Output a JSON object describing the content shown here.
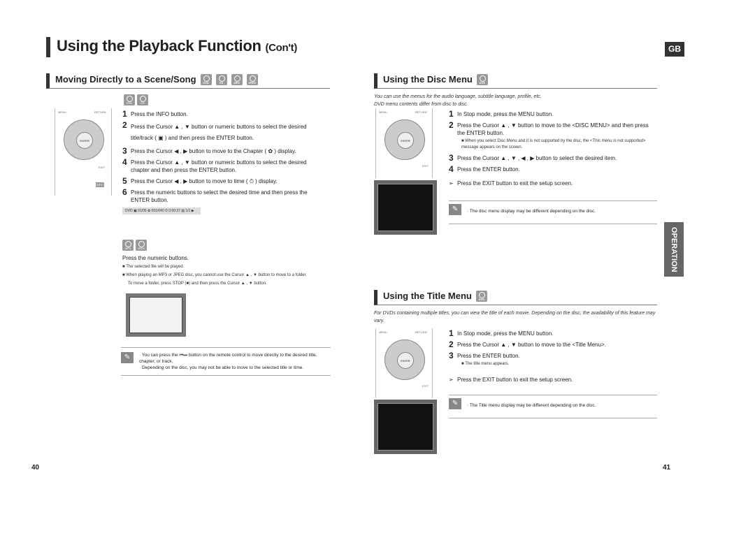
{
  "header": {
    "title": "Using the Playback Function",
    "title_suffix": "(Con't)",
    "lang_badge": "GB"
  },
  "side_tab": "OPERATION",
  "page_left": "40",
  "page_right": "41",
  "scene": {
    "heading": "Moving Directly to a Scene/Song",
    "discs": [
      "DVD",
      "CD",
      "MP3",
      "JPEG"
    ],
    "sub_discs": [
      "DVD",
      "CD"
    ],
    "steps": [
      {
        "n": "1",
        "text": "Press the INFO button."
      },
      {
        "n": "2",
        "text": "Press the Cursor ▲ , ▼ button or numeric buttons to select the desired title/track ( ▣ )  and then press the ENTER button."
      },
      {
        "n": "3",
        "text": "Press the Cursor ◀ , ▶ button to move to the Chapter ( ✿ ) display."
      },
      {
        "n": "4",
        "text": "Press the Cursor ▲ , ▼ button or numeric buttons to select the desired chapter and then press the ENTER button."
      },
      {
        "n": "5",
        "text": "Press the Cursor ◀ , ▶ button to move to time ( ⏱ )  display."
      },
      {
        "n": "6",
        "text": "Press the numeric buttons to select the desired time and then press the ENTER button."
      }
    ],
    "info_bar": "DVD ▣ 01/05 ✿ 001/040 ⏱ 0:00:37 ▤ 1/1 ▶",
    "mp3_discs": [
      "MP3",
      "JPEG"
    ],
    "mp3_lead": "Press the numeric buttons.",
    "mp3_notes": [
      "The selected file will be played.",
      "When playing an MP3 or JPEG disc, you cannot use the Cursor ▲ , ▼ button to move to a folder.",
      "To move a folder, press STOP (■) and then press the Cursor ▲ , ▼ button."
    ],
    "notes": [
      "· You can press the ⏮⏭ button on the remote control to move directly to the desired title, chapter, or track.",
      "· Depending on the disc, you may not be able to move to the selected title or time."
    ]
  },
  "remote": {
    "menu": "MENU",
    "return": "RETURN",
    "enter": "ENTER",
    "exit": "EXIT",
    "info": "INFO"
  },
  "disc_menu": {
    "heading": "Using the Disc Menu",
    "disc": "DVD",
    "intro": "You can use the menus for the audio language, subtitle language, profile, etc.",
    "intro2": "DVD menu contents differ from disc to disc.",
    "steps": [
      {
        "n": "1",
        "text": "In Stop mode, press the MENU button."
      },
      {
        "n": "2",
        "text": "Press the Cursor ▲ , ▼ button to move to the <DISC MENU> and then press the ENTER button."
      },
      {
        "n": "3",
        "text": "Press the Cursor ▲ , ▼ , ◀ , ▶ button to select the desired item."
      },
      {
        "n": "4",
        "text": "Press the ENTER button."
      }
    ],
    "step2_note": "When you select Disc Menu and it is not supported by the disc, the <This menu is not supported> message appears on the screen.",
    "tip": "Press the EXIT button to exit the setup screen.",
    "note": "· The disc menu display may be different depending on the disc."
  },
  "title_menu": {
    "heading": "Using the Title Menu",
    "disc": "DVD",
    "intro": "For DVDs containing multiple titles, you can view the title of each movie. Depending on the disc, the availability of this feature may vary.",
    "steps": [
      {
        "n": "1",
        "text": "In Stop mode, press the MENU button."
      },
      {
        "n": "2",
        "text": "Press the Cursor ▲ , ▼ button to move to the <Title Menu>."
      },
      {
        "n": "3",
        "text": "Press the ENTER button."
      }
    ],
    "step3_note": "The title menu appears.",
    "tip": "Press the EXIT button to exit the setup screen.",
    "note": "· The Title menu display may be different depending on the disc."
  }
}
